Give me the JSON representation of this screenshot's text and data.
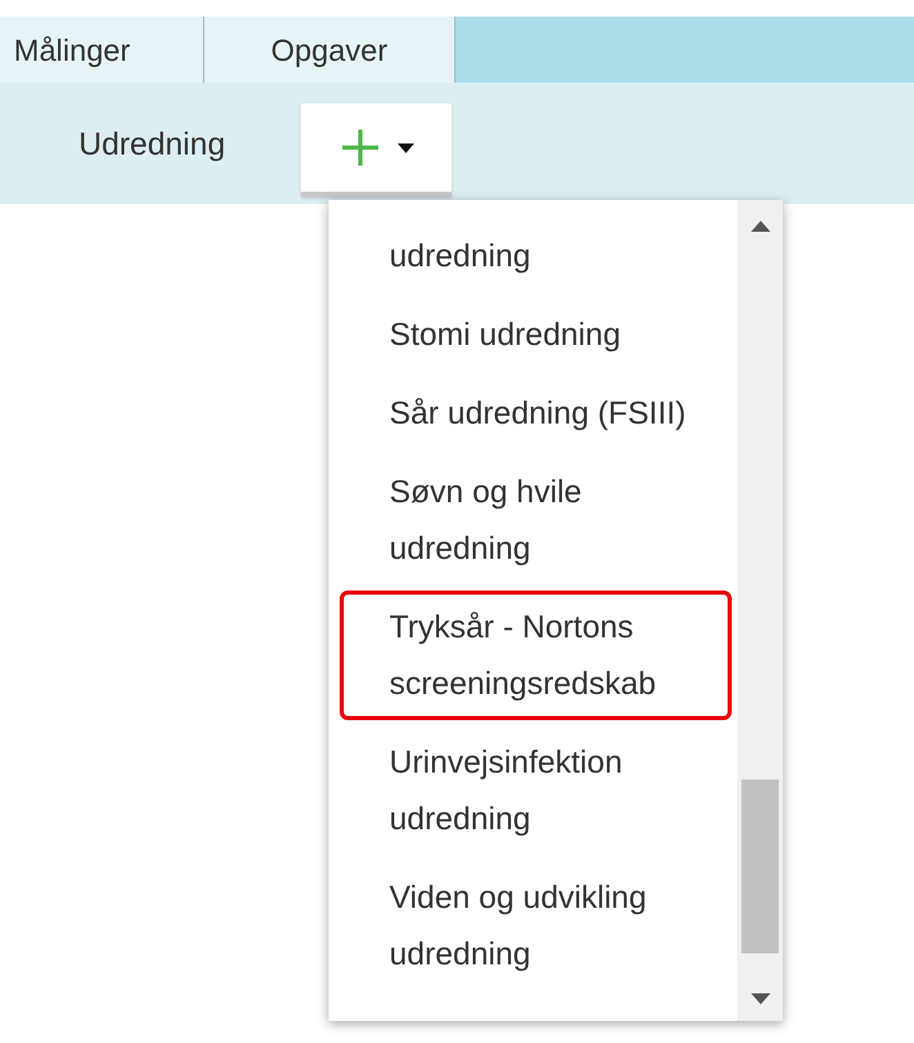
{
  "tabs": [
    {
      "label": "Målinger",
      "selected": false
    },
    {
      "label": "Opgaver",
      "selected": false
    }
  ],
  "toolbar": {
    "label": "Udredning",
    "add_button": {
      "expanded": true
    }
  },
  "dropdown": {
    "items": [
      {
        "label": "udredning",
        "highlighted": false
      },
      {
        "label": "Stomi udredning",
        "highlighted": false
      },
      {
        "label": "Sår udredning (FSIII)",
        "highlighted": false
      },
      {
        "label": "Søvn og hvile udredning",
        "highlighted": false
      },
      {
        "label": "Tryksår - Nortons screeningsredskab",
        "highlighted": true
      },
      {
        "label": "Urinvejsinfektion udredning",
        "highlighted": false
      },
      {
        "label": "Viden og udvikling udredning",
        "highlighted": false
      }
    ]
  }
}
